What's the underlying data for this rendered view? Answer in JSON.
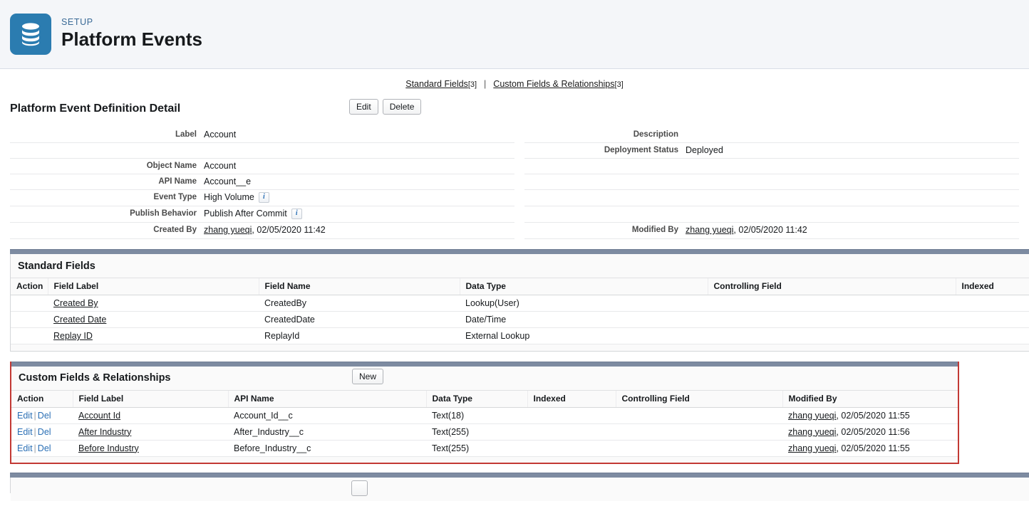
{
  "header": {
    "eyebrow": "SETUP",
    "title": "Platform Events",
    "icon": "database-icon",
    "icon_color": "#2b7cb0"
  },
  "jump_links": {
    "standard_fields": {
      "label": "Standard Fields",
      "count": "[3]"
    },
    "separator": "|",
    "custom_fields": {
      "label": "Custom Fields & Relationships",
      "count": "[3]"
    }
  },
  "detail": {
    "title": "Platform Event Definition Detail",
    "buttons": {
      "edit": "Edit",
      "delete": "Delete"
    },
    "left_rows": [
      {
        "label": "Label",
        "value": "Account"
      },
      {
        "label": "",
        "value": ""
      },
      {
        "label": "Object Name",
        "value": "Account"
      },
      {
        "label": "API Name",
        "value": "Account__e"
      },
      {
        "label": "Event Type",
        "value": "High Volume",
        "info": "i"
      },
      {
        "label": "Publish Behavior",
        "value": "Publish After Commit",
        "info": "i"
      },
      {
        "label": "Created By",
        "value": "zhang yueqi",
        "suffix": ", 02/05/2020 11:42"
      }
    ],
    "right_rows": [
      {
        "label": "Description",
        "value": ""
      },
      {
        "label": "Deployment Status",
        "value": "Deployed"
      },
      {
        "label": "",
        "value": ""
      },
      {
        "label": "",
        "value": ""
      },
      {
        "label": "",
        "value": ""
      },
      {
        "label": "",
        "value": ""
      },
      {
        "label": "Modified By",
        "value": "zhang yueqi",
        "suffix": ", 02/05/2020 11:42"
      }
    ]
  },
  "standard_fields": {
    "title": "Standard Fields",
    "columns": [
      "Action",
      "Field Label",
      "Field Name",
      "Data Type",
      "Controlling Field",
      "Indexed"
    ],
    "rows": [
      {
        "action": "",
        "field_label": "Created By",
        "field_name": "CreatedBy",
        "data_type": "Lookup(User)",
        "controlling_field": "",
        "indexed": ""
      },
      {
        "action": "",
        "field_label": "Created Date",
        "field_name": "CreatedDate",
        "data_type": "Date/Time",
        "controlling_field": "",
        "indexed": ""
      },
      {
        "action": "",
        "field_label": "Replay ID",
        "field_name": "ReplayId",
        "data_type": "External Lookup",
        "controlling_field": "",
        "indexed": ""
      }
    ]
  },
  "custom_fields": {
    "title": "Custom Fields & Relationships",
    "new_button": "New",
    "highlight_color": "#c23934",
    "columns": [
      "Action",
      "Field Label",
      "API Name",
      "Data Type",
      "Indexed",
      "Controlling Field",
      "Modified By"
    ],
    "action_edit": "Edit",
    "action_sep": "|",
    "action_del": "Del",
    "rows": [
      {
        "field_label": "Account Id",
        "api_name": "Account_Id__c",
        "data_type": "Text(18)",
        "indexed": "",
        "controlling_field": "",
        "modified_user": "zhang yueqi",
        "modified_suffix": ", 02/05/2020 11:55"
      },
      {
        "field_label": "After Industry",
        "api_name": "After_Industry__c",
        "data_type": "Text(255)",
        "indexed": "",
        "controlling_field": "",
        "modified_user": "zhang yueqi",
        "modified_suffix": ", 02/05/2020 11:56"
      },
      {
        "field_label": "Before Industry",
        "api_name": "Before_Industry__c",
        "data_type": "Text(255)",
        "indexed": "",
        "controlling_field": "",
        "modified_user": "zhang yueqi",
        "modified_suffix": ", 02/05/2020 11:55"
      }
    ]
  }
}
